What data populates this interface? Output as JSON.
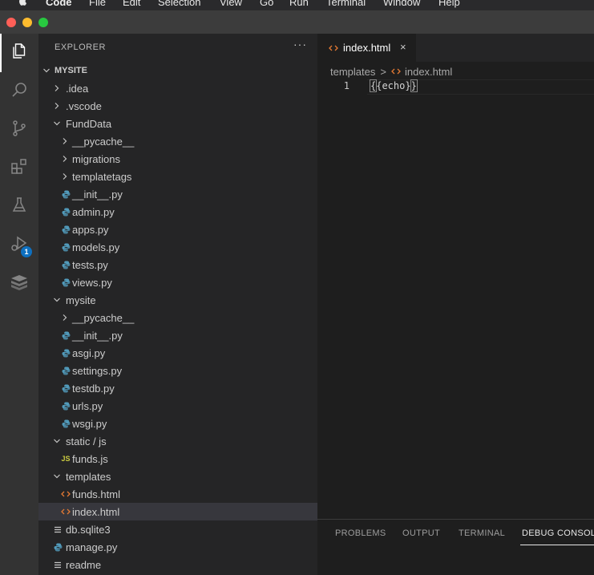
{
  "menubar": {
    "app_name": "Code",
    "items": [
      "File",
      "Edit",
      "Selection",
      "View",
      "Go",
      "Run",
      "Terminal",
      "Window",
      "Help"
    ]
  },
  "window": {
    "traffic_lights": {
      "close": "#ff5f57",
      "minimize": "#febc2e",
      "zoom": "#28c840"
    }
  },
  "activity_bar": {
    "items": [
      {
        "icon": "files-icon",
        "active": true
      },
      {
        "icon": "search-icon",
        "active": false
      },
      {
        "icon": "source-control-icon",
        "active": false
      },
      {
        "icon": "extensions-icon",
        "active": false
      },
      {
        "icon": "testing-flask-icon",
        "active": false
      },
      {
        "icon": "run-debug-icon",
        "active": false,
        "badge": "1"
      },
      {
        "icon": "database-icon",
        "active": false
      }
    ]
  },
  "explorer": {
    "title": "EXPLORER",
    "more": "···",
    "root": "MYSITE",
    "tree": [
      {
        "label": ".idea",
        "type": "folder",
        "expanded": false
      },
      {
        "label": ".vscode",
        "type": "folder",
        "expanded": false
      },
      {
        "label": "FundData",
        "type": "folder",
        "expanded": true
      },
      {
        "label": "__pycache__",
        "type": "folder",
        "expanded": false
      },
      {
        "label": "migrations",
        "type": "folder",
        "expanded": false
      },
      {
        "label": "templatetags",
        "type": "folder",
        "expanded": false
      },
      {
        "label": "__init__.py",
        "type": "python"
      },
      {
        "label": "admin.py",
        "type": "python"
      },
      {
        "label": "apps.py",
        "type": "python"
      },
      {
        "label": "models.py",
        "type": "python"
      },
      {
        "label": "tests.py",
        "type": "python"
      },
      {
        "label": "views.py",
        "type": "python"
      },
      {
        "label": "mysite",
        "type": "folder",
        "expanded": true
      },
      {
        "label": "__pycache__",
        "type": "folder",
        "expanded": false
      },
      {
        "label": "__init__.py",
        "type": "python"
      },
      {
        "label": "asgi.py",
        "type": "python"
      },
      {
        "label": "settings.py",
        "type": "python"
      },
      {
        "label": "testdb.py",
        "type": "python"
      },
      {
        "label": "urls.py",
        "type": "python"
      },
      {
        "label": "wsgi.py",
        "type": "python"
      },
      {
        "label": "static / js",
        "type": "folder",
        "expanded": true
      },
      {
        "label": "funds.js",
        "type": "js",
        "icon_text": "JS"
      },
      {
        "label": "templates",
        "type": "folder",
        "expanded": true
      },
      {
        "label": "funds.html",
        "type": "html"
      },
      {
        "label": "index.html",
        "type": "html",
        "selected": true
      },
      {
        "label": "db.sqlite3",
        "type": "text"
      },
      {
        "label": "manage.py",
        "type": "python"
      },
      {
        "label": "readme",
        "type": "text"
      }
    ]
  },
  "editor": {
    "tab": {
      "label": "index.html",
      "close": "×"
    },
    "breadcrumb": {
      "folder": "templates",
      "separator": ">",
      "file": "index.html"
    },
    "lines": [
      {
        "number": "1",
        "open": "{",
        "content": "{echo}",
        "close": "}"
      }
    ]
  },
  "panel": {
    "tabs": [
      "PROBLEMS",
      "OUTPUT",
      "TERMINAL",
      "DEBUG CONSOLE"
    ],
    "active_tab": "DEBUG CONSOLE"
  },
  "colors": {
    "accent": "#0e70c0",
    "html_icon": "#e37933",
    "python_icon": "#519aba",
    "js_icon": "#cbcb41"
  }
}
